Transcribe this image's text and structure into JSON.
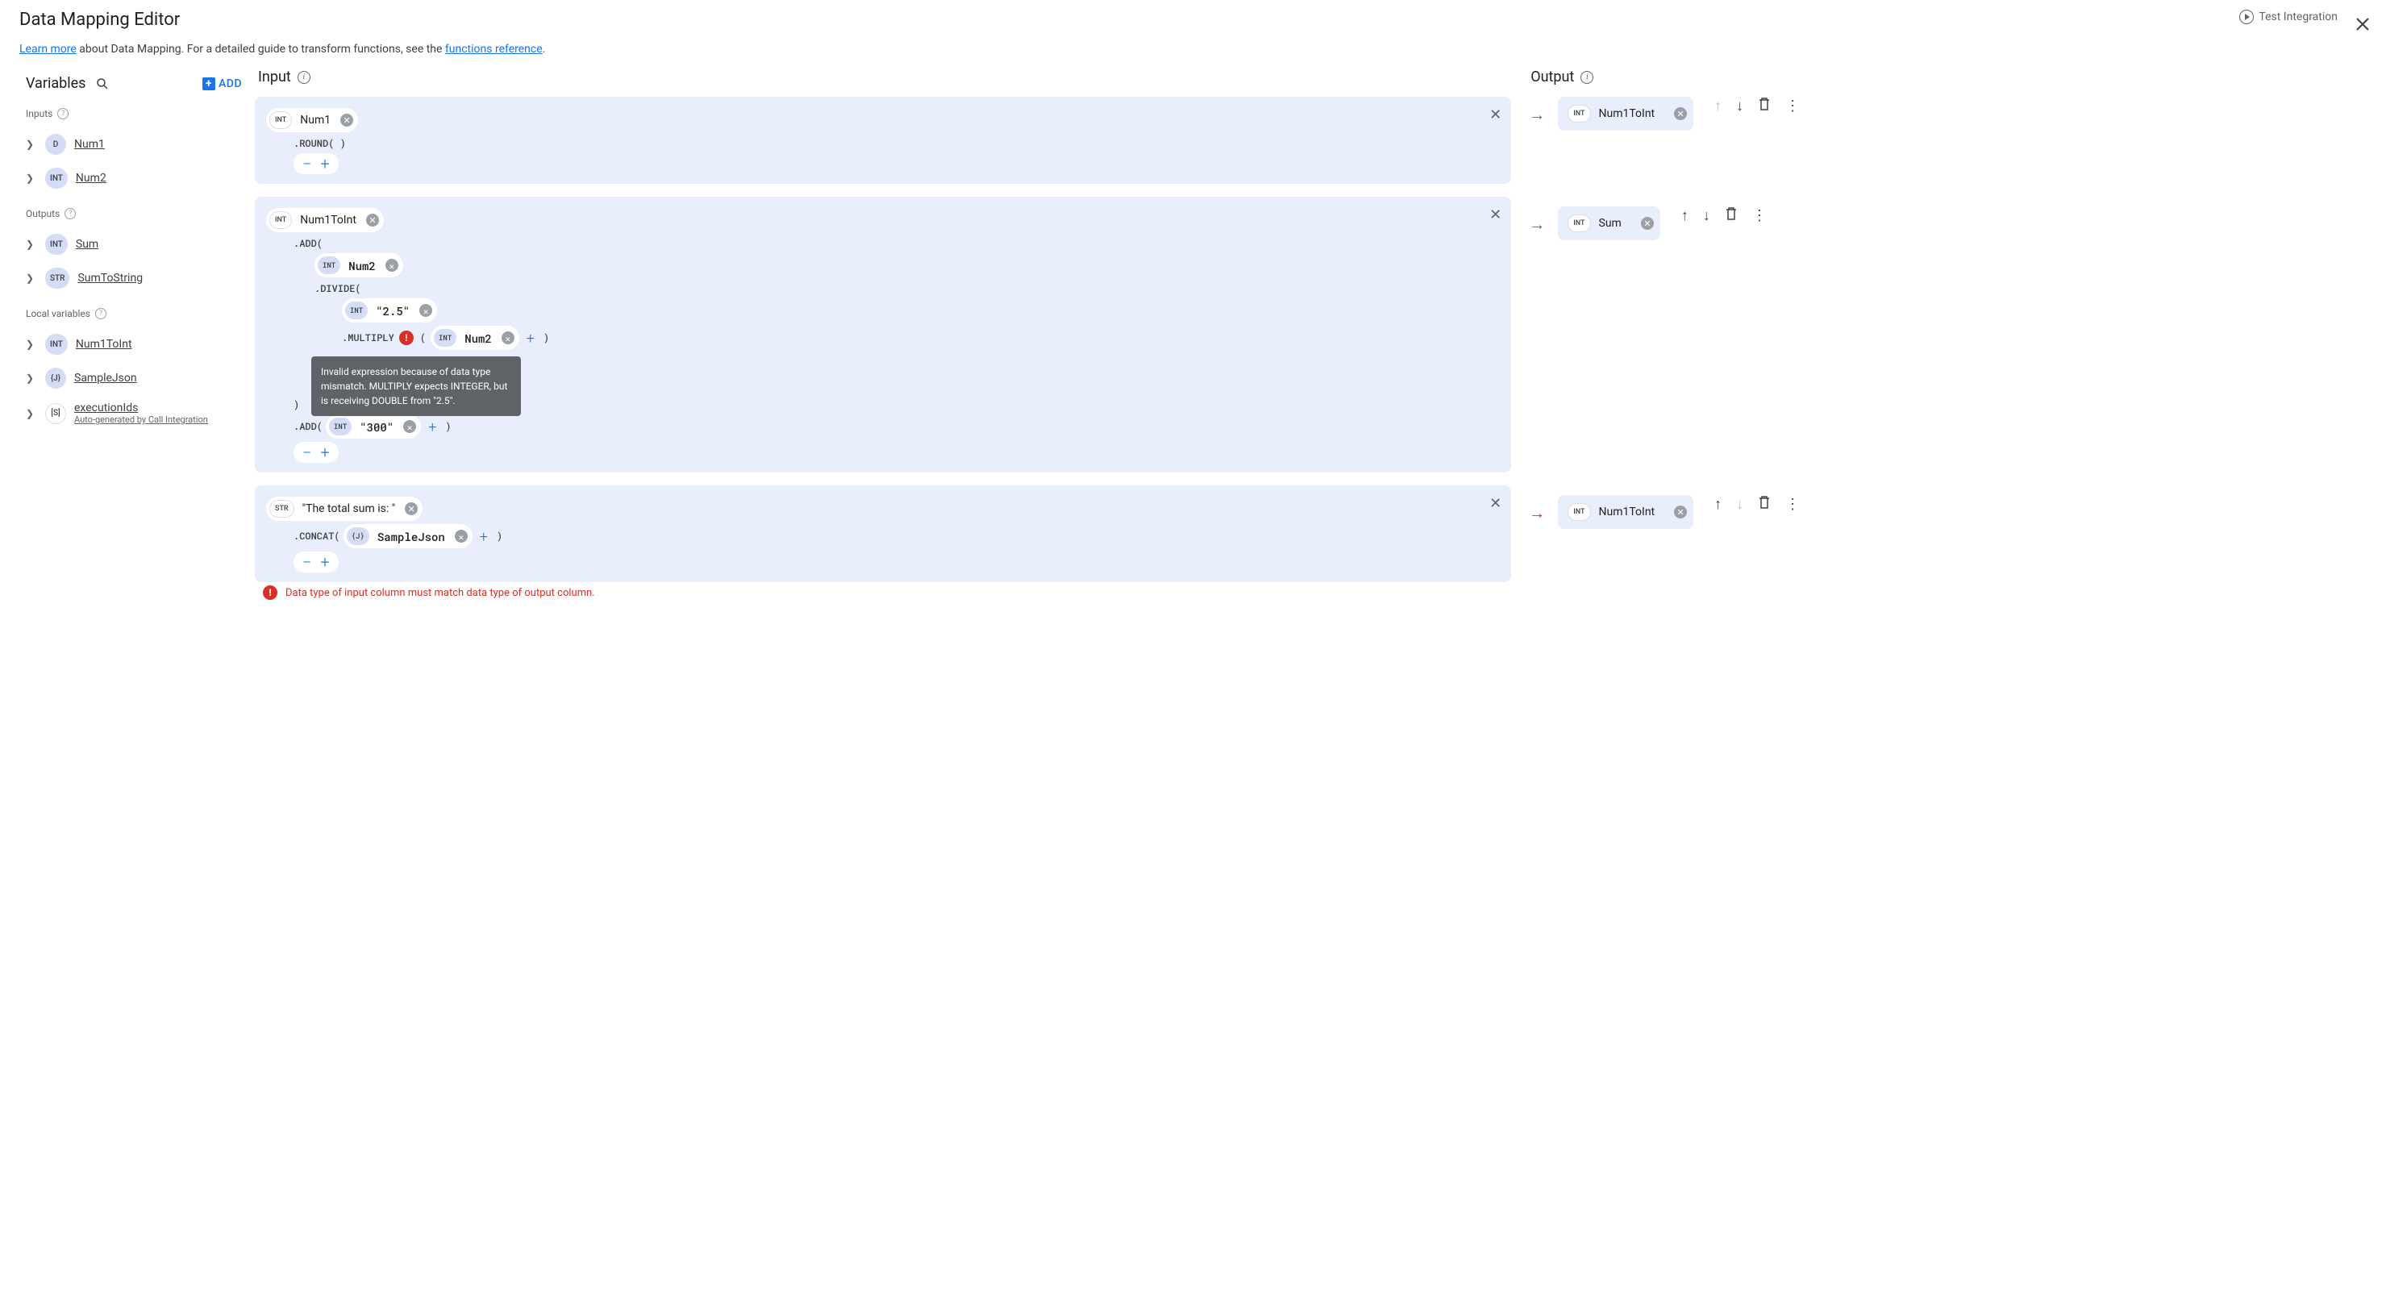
{
  "header": {
    "title": "Data Mapping Editor",
    "test_integration": "Test Integration",
    "subtext_1": "Learn more",
    "subtext_2": " about Data Mapping. For a detailed guide to transform functions, see the ",
    "subtext_3": "functions reference",
    "subtext_4": "."
  },
  "sidebar": {
    "title": "Variables",
    "add_label": "ADD",
    "inputs_label": "Inputs",
    "outputs_label": "Outputs",
    "local_label": "Local variables",
    "inputs": [
      {
        "type": "D",
        "name": "Num1"
      },
      {
        "type": "INT",
        "name": "Num2"
      }
    ],
    "outputs": [
      {
        "type": "INT",
        "name": "Sum"
      },
      {
        "type": "STR",
        "name": "SumToString"
      }
    ],
    "locals": [
      {
        "type": "INT",
        "name": "Num1ToInt"
      },
      {
        "type": "{J}",
        "name": "SampleJson"
      },
      {
        "type": "[S]",
        "name": "executionIds",
        "sub": "Auto-generated by Call Integration"
      }
    ]
  },
  "columns": {
    "input_label": "Input",
    "output_label": "Output"
  },
  "rows": [
    {
      "input": {
        "type": "INT",
        "name": "Num1",
        "fn": ".ROUND( )"
      },
      "output": {
        "type": "INT",
        "name": "Num1ToInt"
      }
    },
    {
      "input": {
        "type": "INT",
        "name": "Num1ToInt"
      },
      "output": {
        "type": "INT",
        "name": "Sum"
      },
      "fn_add": ".ADD(",
      "add_arg": {
        "type": "INT",
        "name": "Num2"
      },
      "fn_divide": ".DIVIDE(",
      "divide_arg": {
        "type": "INT",
        "name": "\"2.5\""
      },
      "fn_multiply": ".MULTIPLY",
      "multiply_arg": {
        "type": "INT",
        "name": "Num2"
      },
      "close_paren": ")",
      "fn_add2": ".ADD(",
      "add2_arg": {
        "type": "INT",
        "name": "\"300\""
      },
      "tooltip": "Invalid expression because of data type mismatch. MULTIPLY expects INTEGER, but is receiving DOUBLE from \"2.5\"."
    },
    {
      "input": {
        "type": "STR",
        "name": "\"The total sum is: \""
      },
      "output": {
        "type": "INT",
        "name": "Num1ToInt"
      },
      "fn_concat": ".CONCAT(",
      "concat_arg": {
        "type": "{J}",
        "name": "SampleJson"
      },
      "error": true
    }
  ],
  "error_message": "Data type of input column must match data type of output column."
}
